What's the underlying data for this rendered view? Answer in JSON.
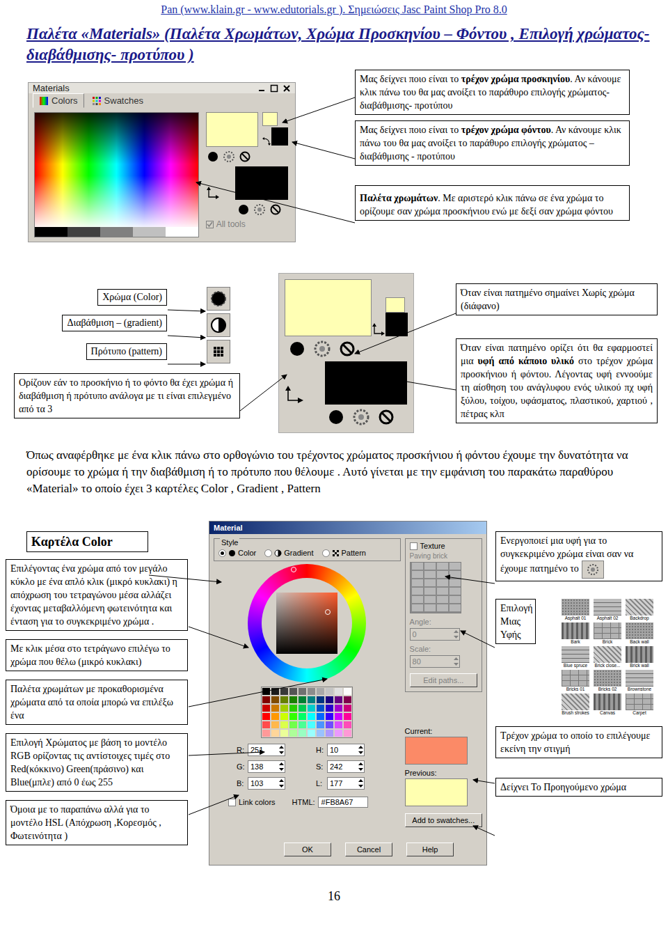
{
  "header": "Pan (www.klain.gr - www.edutorials.gr ). Σημειώσεις Jasc Paint Shop Pro 8.0",
  "title": "Παλέτα «Materials» (Παλέτα Χρωμάτων, Χρώμα Προσκηνίου – Φόντου , Επιλογή χρώματος- διαβάθμισης- προτύπου )",
  "palette": {
    "title": "Materials",
    "tabs": [
      {
        "label": "Colors",
        "selected": true
      },
      {
        "label": "Swatches",
        "selected": false
      }
    ],
    "all_tools": {
      "label": "All tools",
      "checked": true,
      "disabled": true
    }
  },
  "palette_notes": [
    {
      "parts": [
        {
          "text": "Μας δείχνει ποιο είναι το ",
          "bold": false
        },
        {
          "text": "τρέχον χρώμα προσκηνίου",
          "bold": true
        },
        {
          "text": ". Αν κάνουμε κλικ πάνω του θα μας ανοίξει το παράθυρο επιλογής χρώματος- διαβάθμισης- προτύπου",
          "bold": false
        }
      ]
    },
    {
      "parts": [
        {
          "text": "Μας δείχνει ποιο είναι το ",
          "bold": false
        },
        {
          "text": "τρέχον χρώμα φόντου",
          "bold": true
        },
        {
          "text": ". Αν κάνουμε κλικ πάνω του θα μας ανοίξει το παράθυρο επιλογής χρώματος – διαβάθμισης - προτύπου",
          "bold": false
        }
      ]
    },
    {
      "parts": [
        {
          "text": "Παλέτα χρωμάτων",
          "bold": true
        },
        {
          "text": ". Με αριστερό κλικ πάνω σε ένα χρώμα το ορίζουμε σαν χρώμα προσκήνιου ενώ με δεξί σαν χρώμα φόντου",
          "bold": false
        }
      ]
    }
  ],
  "style_labels": [
    "Χρώμα (Color)",
    "Διαβάθμιση – (gradient)",
    "Πρότυπο (pattern)"
  ],
  "style_note": "Ορίζουν εάν το προσκήνιο ή το φόντο θα έχει χρώμα ή διαβάθμιση ή πρότυπο ανάλογα με τι είναι επιλεγμένο από τα 3",
  "button_notes": [
    {
      "parts": [
        {
          "text": "Όταν είναι πατημένο σημαίνει Χωρίς χρώμα (διάφανο)",
          "bold": false
        }
      ]
    },
    {
      "parts": [
        {
          "text": "Όταν είναι πατημένο ορίζει ότι θα εφαρμοστεί μια ",
          "bold": false
        },
        {
          "text": "υφή από κάποιο υλικό",
          "bold": true
        },
        {
          "text": " στο τρέχον χρώμα προσκήνιου ή φόντου. Λέγοντας υφή εννοούμε τη αίσθηση του ανάγλυφου ενός υλικού πχ υφή ξύλου, τοίχου, υφάσματος, πλαστικού, χαρτιού , πέτρας κλπ",
          "bold": false
        }
      ]
    }
  ],
  "paragraph": "Όπως αναφέρθηκε με ένα κλικ πάνω στο ορθογώνιο του τρέχοντος χρώματος προσκήνιου ή φόντου έχουμε την δυνατότητα να ορίσουμε το χρώμα ή την διαβάθμιση ή το πρότυπο που θέλουμε . Αυτό γίνεται με την εμφάνιση του παρακάτω παραθύρου «Material» το οποίο έχει 3 καρτέλες Color , Gradient , Pattern",
  "color_tab": {
    "heading": "Καρτέλα Color",
    "notes": [
      "Επιλέγοντας ένα χρώμα από τον μεγάλο κύκλο με ένα απλό κλικ (μικρό κυκλακι) η απόχρωση του τετραγώνου μέσα αλλάζει έχοντας μεταβαλλόμενη φωτεινότητα και ένταση για το συγκεκριμένο χρώμα .",
      "Με κλικ μέσα στο τετράγωνο επιλέγω το χρώμα που θέλω (μικρό κυκλακι)",
      "Παλέτα χρωμάτων με προκαθορισμένα χρώματα από τα οποία μπορώ να επιλέξω ένα",
      "Επιλογή Χρώματος με βάση το μοντέλο RGB ορίζοντας τις αντίστοιχες τιμές στο Red(κόκκινο) Green(πράσινο) και Blue(μπλε) από 0 έως 255",
      "Όμοια με το παραπάνω αλλά για το μοντέλο HSL (Απόχρωση ,Κορεσμός , Φωτεινότητα )"
    ]
  },
  "material": {
    "title": "Material",
    "style": {
      "label": "Style",
      "options": [
        {
          "label": "Color",
          "selected": true
        },
        {
          "label": "Gradient",
          "selected": false
        },
        {
          "label": "Pattern",
          "selected": false
        }
      ]
    },
    "texture": {
      "label": "Texture",
      "checked": false,
      "name": "Paving brick",
      "angle_label": "Angle:",
      "angle": "0",
      "scale_label": "Scale:",
      "scale": "80",
      "edit_paths": "Edit paths..."
    },
    "samples": [
      {
        "label": "Current:",
        "color": "#FB8A67"
      },
      {
        "label": "Previous:",
        "color": "#FFFFB0"
      }
    ],
    "add_to_swatches": "Add to swatches...",
    "rgb": [
      {
        "label": "R:",
        "value": "251"
      },
      {
        "label": "G:",
        "value": "138"
      },
      {
        "label": "B:",
        "value": "103"
      }
    ],
    "hsl": [
      {
        "label": "H:",
        "value": "10"
      },
      {
        "label": "S:",
        "value": "242"
      },
      {
        "label": "L:",
        "value": "177"
      }
    ],
    "link_colors": {
      "label": "Link colors",
      "checked": false
    },
    "html_label": "HTML:",
    "html": "#FB8A67",
    "buttons": [
      "OK",
      "Cancel",
      "Help"
    ]
  },
  "texture_note": "Ενεργοποιεί μια υφή για το συγκεκριμένο χρώμα είναι σαν να έχουμε πατημένο το",
  "texture_pick": "Επιλογή Μιας Υφής",
  "textures": [
    "Asphalt 01",
    "Asphalt 02",
    "Backdrop",
    "Bark",
    "Brick",
    "Back wall",
    "Blue spruce",
    "Brick close...",
    "Brick wall",
    "Bricks 01",
    "Bricks 02",
    "Brownstone",
    "Brush strokes",
    "Canvas",
    "Carpet"
  ],
  "current_note": "Τρέχον χρώμα το οποίο το επιλέγουμε εκείνη την στιγμή",
  "previous_note": "Δείχνει Το Προηγούμενο χρώμα",
  "page_number": "16"
}
